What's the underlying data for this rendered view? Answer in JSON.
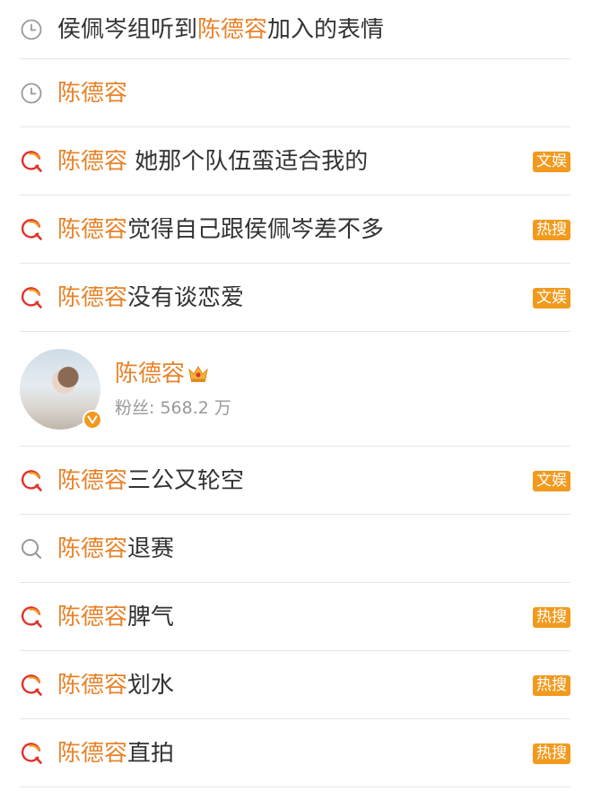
{
  "suggestions": [
    {
      "type": "history",
      "icon": "clock-icon",
      "prefix": "侯佩岑组听到",
      "highlight": "陈德容",
      "suffix": "加入的表情",
      "badge": ""
    },
    {
      "type": "history",
      "icon": "clock-icon",
      "prefix": "",
      "highlight": "陈德容",
      "suffix": "",
      "badge": ""
    },
    {
      "type": "hot",
      "icon": "hot-search-icon",
      "prefix": "",
      "highlight": "陈德容",
      "suffix": " 她那个队伍蛮适合我的",
      "badge": "文娱"
    },
    {
      "type": "hot",
      "icon": "hot-search-icon",
      "prefix": "",
      "highlight": "陈德容",
      "suffix": "觉得自己跟侯佩岑差不多",
      "badge": "热搜"
    },
    {
      "type": "hot",
      "icon": "hot-search-icon",
      "prefix": "",
      "highlight": "陈德容",
      "suffix": "没有谈恋爱",
      "badge": "文娱"
    }
  ],
  "user_card": {
    "name": "陈德容",
    "fans_label": "粉丝: 568.2 万",
    "verified_icon": "verified-v-icon",
    "crown_icon": "crown-icon"
  },
  "more_suggestions": [
    {
      "type": "hot",
      "icon": "hot-search-icon",
      "highlight": "陈德容",
      "suffix": "三公又轮空",
      "badge": "文娱"
    },
    {
      "type": "search",
      "icon": "search-icon",
      "highlight": "陈德容",
      "suffix": "退赛",
      "badge": ""
    },
    {
      "type": "hot",
      "icon": "hot-search-icon",
      "highlight": "陈德容",
      "suffix": "脾气",
      "badge": "热搜"
    },
    {
      "type": "hot",
      "icon": "hot-search-icon",
      "highlight": "陈德容",
      "suffix": "划水",
      "badge": "热搜"
    },
    {
      "type": "hot",
      "icon": "hot-search-icon",
      "highlight": "陈德容",
      "suffix": "直拍",
      "badge": "热搜"
    }
  ],
  "colors": {
    "highlight": "#e8832a",
    "badge_bg": "#f29a1e",
    "hot_icon_red": "#e2322a",
    "hot_icon_orange": "#f29a1e",
    "icon_gray": "#999999",
    "divider": "#e6e6e6"
  }
}
